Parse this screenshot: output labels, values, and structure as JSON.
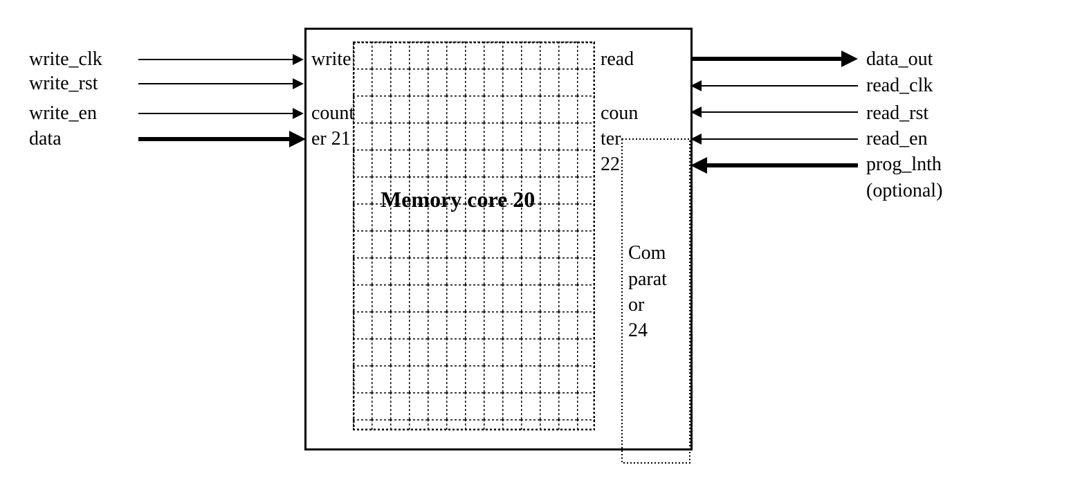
{
  "left_signals": {
    "write_clk": "write_clk",
    "write_rst": "write_rst",
    "write_en": "write_en",
    "data": "data"
  },
  "right_signals": {
    "data_out": "data_out",
    "read_clk": "read_clk",
    "read_rst": "read_rst",
    "read_en": "read_en",
    "prog_lnth": "prog_lnth",
    "optional": "(optional)"
  },
  "blocks": {
    "write_counter_top": "write",
    "write_counter_mid": "count",
    "write_counter_bot": "er 21",
    "read_counter_top": "read",
    "read_counter_mid": "coun",
    "read_counter_bot1": "ter",
    "read_counter_bot2": "22",
    "memory_core": "Memory core 20",
    "comparator_1": "Com",
    "comparator_2": "parat",
    "comparator_3": "or",
    "comparator_4": "24"
  }
}
